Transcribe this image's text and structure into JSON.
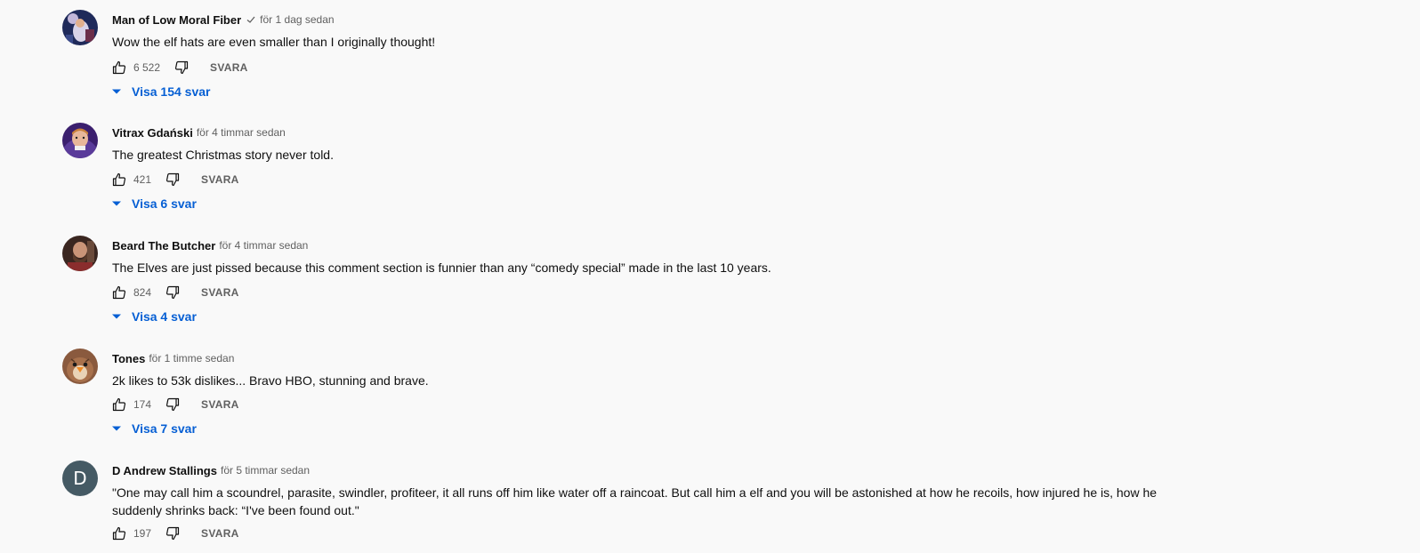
{
  "colors": {
    "link": "#065fd4",
    "meta": "#606060",
    "background": "#f9f9f9"
  },
  "reply_label": "SVARA",
  "comments": [
    {
      "author": "Man of Low Moral Fiber",
      "verified": true,
      "time": "för 1 dag sedan",
      "text": "Wow the elf hats are even smaller than I originally thought!",
      "likes": "6 522",
      "replies": "Visa 154 svar",
      "avatar": "photo-avatar"
    },
    {
      "author": "Vitrax Gdański",
      "verified": false,
      "time": "för 4 timmar sedan",
      "text": "The greatest Christmas story never told.",
      "likes": "421",
      "replies": "Visa 6 svar",
      "avatar": "photo-avatar"
    },
    {
      "author": "Beard The Butcher",
      "verified": false,
      "time": "för 4 timmar sedan",
      "text": "The Elves are just pissed because this comment section is funnier than any “comedy special” made in the last 10 years.",
      "likes": "824",
      "replies": "Visa 4 svar",
      "avatar": "photo-avatar"
    },
    {
      "author": "Tones",
      "verified": false,
      "time": "för 1 timme sedan",
      "text": "2k likes to 53k dislikes... Bravo HBO, stunning and brave.",
      "likes": "174",
      "replies": "Visa 7 svar",
      "avatar": "bird-avatar"
    },
    {
      "author": "D Andrew Stallings",
      "verified": false,
      "time": "för 5 timmar sedan",
      "text": "\"One may call him a scoundrel, parasite, swindler, profiteer, it all runs off him like water off a raincoat. But call him a elf and you will be astonished at how he recoils, how injured he is, how he suddenly shrinks back: “I've been found out.\"",
      "likes": "197",
      "replies": "",
      "avatar": "letter-avatar",
      "avatar_letter": "D"
    }
  ]
}
